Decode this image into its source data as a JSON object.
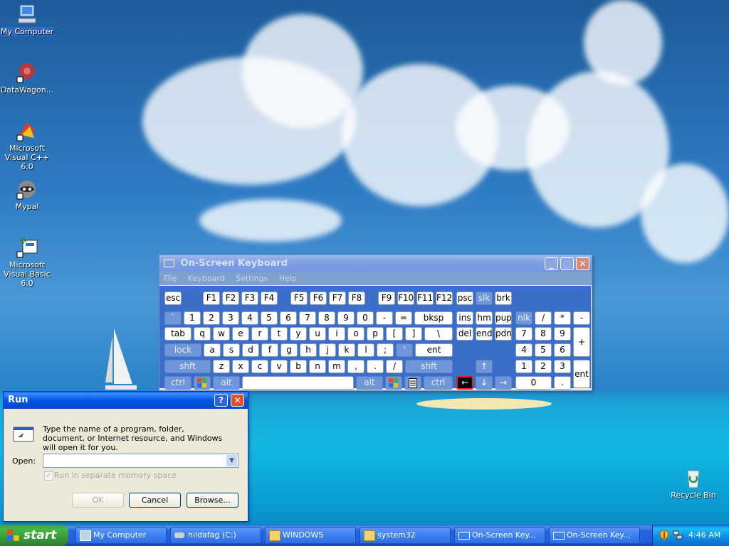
{
  "desktop": {
    "icons": [
      {
        "label": "My Computer",
        "selected": true
      },
      {
        "label": "DataWagon..."
      },
      {
        "label": "Microsoft Visual C++ 6.0"
      },
      {
        "label": "Mypal"
      },
      {
        "label": "Microsoft Visual Basic 6.0"
      },
      {
        "label": "Recycle Bin"
      }
    ]
  },
  "osk": {
    "title": "On-Screen Keyboard",
    "menu": [
      "File",
      "Keyboard",
      "Settings",
      "Help"
    ],
    "keys": {
      "esc": "esc",
      "f1": "F1",
      "f2": "F2",
      "f3": "F3",
      "f4": "F4",
      "f5": "F5",
      "f6": "F6",
      "f7": "F7",
      "f8": "F8",
      "f9": "F9",
      "f10": "F10",
      "f11": "F11",
      "f12": "F12",
      "psc": "psc",
      "slk": "slk",
      "brk": "brk",
      "backtick": "`",
      "k1": "1",
      "k2": "2",
      "k3": "3",
      "k4": "4",
      "k5": "5",
      "k6": "6",
      "k7": "7",
      "k8": "8",
      "k9": "9",
      "k0": "0",
      "minus": "-",
      "equal": "=",
      "bksp": "bksp",
      "ins": "ins",
      "hm": "hm",
      "pup": "pup",
      "nlk": "nlk",
      "ndiv": "/",
      "nmul": "*",
      "nsub": "-",
      "tab": "tab",
      "q": "q",
      "w": "w",
      "e": "e",
      "r": "r",
      "t": "t",
      "y": "y",
      "u": "u",
      "i": "i",
      "o": "o",
      "p": "p",
      "lbr": "[",
      "rbr": "]",
      "bslash": "\\",
      "del": "del",
      "end": "end",
      "pdn": "pdn",
      "n7": "7",
      "n8": "8",
      "n9": "9",
      "nadd": "+",
      "lock": "lock",
      "a": "a",
      "s": "s",
      "d": "d",
      "f": "f",
      "g": "g",
      "h": "h",
      "j": "j",
      "k": "k",
      "l": "l",
      "semi": ";",
      "quote": "'",
      "ent": "ent",
      "n4": "4",
      "n5": "5",
      "n6": "6",
      "shft": "shft",
      "z": "z",
      "x": "x",
      "c": "c",
      "v": "v",
      "b": "b",
      "n": "n",
      "m": "m",
      "comma": ",",
      "period": ".",
      "slash": "/",
      "shft2": "shft",
      "n1": "1",
      "n2": "2",
      "n3": "3",
      "nent": "ent",
      "ctrl": "ctrl",
      "alt": "alt",
      "alt2": "alt",
      "ctrl2": "ctrl",
      "n0": "0",
      "ndot": "."
    }
  },
  "run": {
    "title": "Run",
    "description": "Type the name of a program, folder, document, or Internet resource, and Windows will open it for you.",
    "open_label": "Open:",
    "open_value": "",
    "checkbox_label": "Run in separate memory space",
    "ok": "OK",
    "cancel": "Cancel",
    "browse": "Browse..."
  },
  "taskbar": {
    "start": "start",
    "tasks": [
      "My Computer",
      "hildafag (C:)",
      "WINDOWS",
      "system32",
      "On-Screen Key...",
      "On-Screen Key..."
    ],
    "clock": "4:46 AM"
  },
  "colors": {
    "title_active": "#0055e5",
    "title_inactive": "#7a9de0",
    "osk_bg": "#3a6ec8",
    "taskbar": "#245edb",
    "start": "#389b38"
  }
}
